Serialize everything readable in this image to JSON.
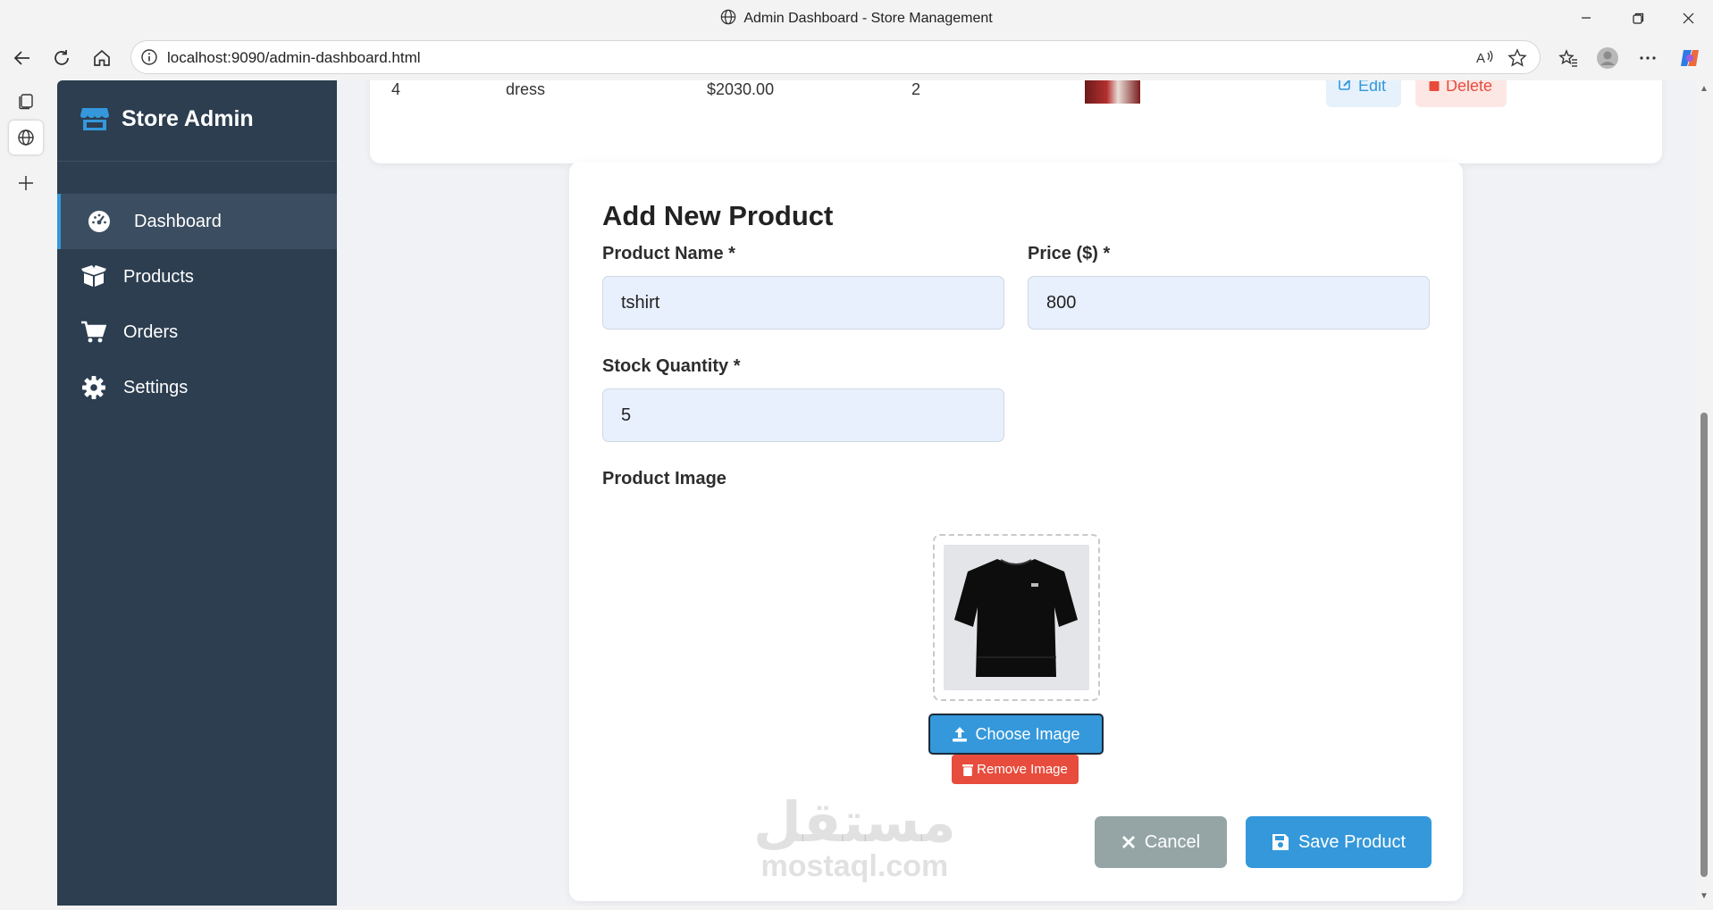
{
  "window": {
    "title": "Admin Dashboard - Store Management"
  },
  "browser": {
    "url": "localhost:9090/admin-dashboard.html"
  },
  "sidebar": {
    "brand": "Store Admin",
    "items": [
      {
        "label": "Dashboard",
        "icon": "gauge-icon",
        "active": true
      },
      {
        "label": "Products",
        "icon": "box-icon",
        "active": false
      },
      {
        "label": "Orders",
        "icon": "cart-icon",
        "active": false
      },
      {
        "label": "Settings",
        "icon": "gear-icon",
        "active": false
      }
    ]
  },
  "product_table": {
    "visible_row": {
      "id": "4",
      "name": "dress",
      "price": "$2030.00",
      "stock": "2",
      "edit_label": "Edit",
      "delete_label": "Delete"
    }
  },
  "form": {
    "title": "Add New Product",
    "product_name": {
      "label": "Product Name *",
      "value": "tshirt"
    },
    "price": {
      "label": "Price ($) *",
      "value": "800"
    },
    "stock": {
      "label": "Stock Quantity *",
      "value": "5"
    },
    "image": {
      "label": "Product Image",
      "choose_label": "Choose Image",
      "remove_label": "Remove Image"
    },
    "cancel_label": "Cancel",
    "save_label": "Save Product"
  },
  "watermark": {
    "arabic": "مستقل",
    "latin": "mostaql.com"
  },
  "colors": {
    "sidebar": "#2c3e50",
    "accent": "#3498db",
    "danger": "#e74c3c",
    "neutral": "#95a5a6",
    "input_bg": "#e8f0fe"
  }
}
